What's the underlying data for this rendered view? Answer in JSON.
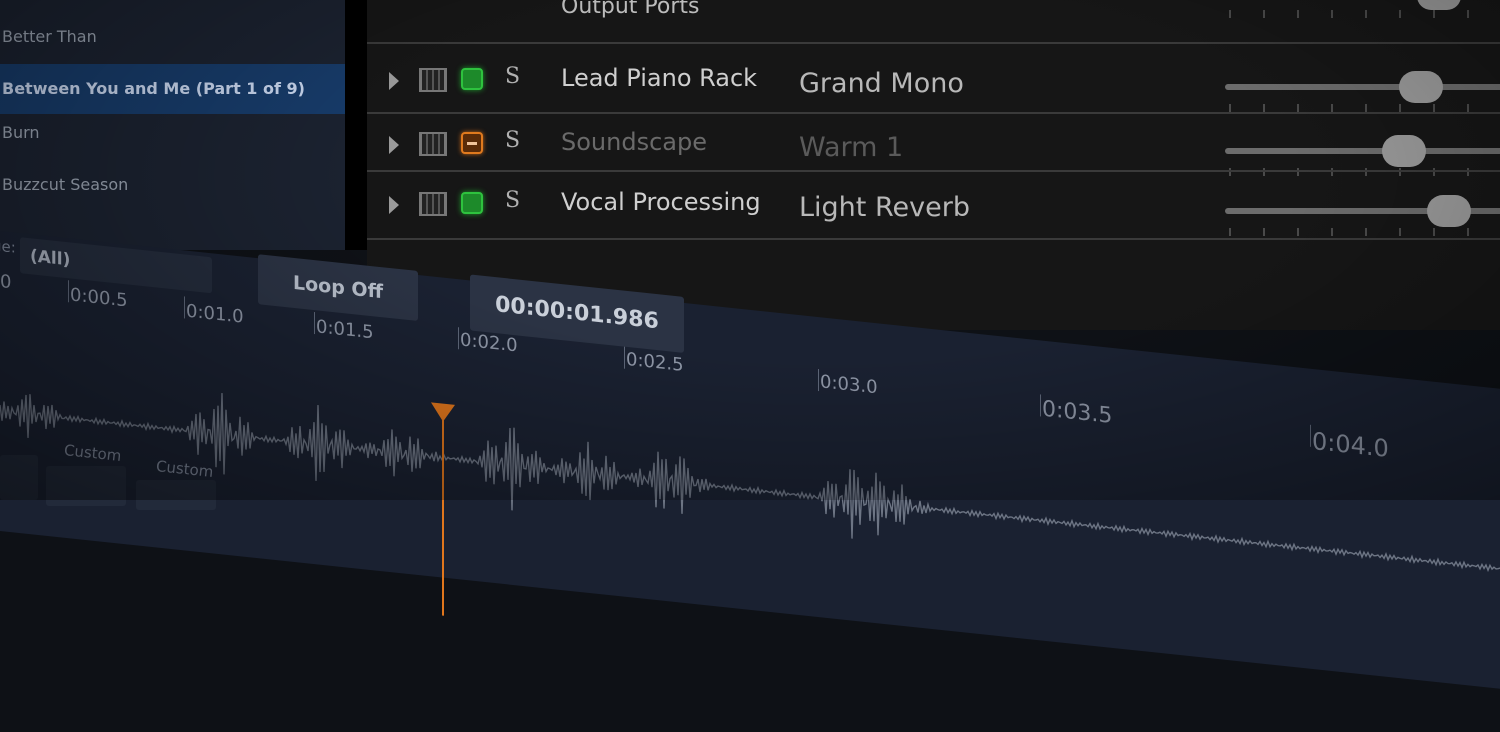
{
  "song_list": {
    "items": [
      {
        "label": "Better Than",
        "selected": false
      },
      {
        "label": "Between You and Me (Part 1 of 9)",
        "selected": true
      },
      {
        "label": "Burn",
        "selected": false
      },
      {
        "label": "Buzzcut Season",
        "selected": false
      }
    ],
    "filter_label": "ge:",
    "filter_value": "(All)"
  },
  "rack_panel": {
    "header": "Output Ports",
    "tracks": [
      {
        "name": "Lead Piano Rack",
        "preset": "Grand Mono",
        "led": "green",
        "solo": "S",
        "dim": false,
        "level": 0.7
      },
      {
        "name": "Soundscape",
        "preset": "Warm 1",
        "led": "orange",
        "solo": "S",
        "dim": true,
        "level": 0.64
      },
      {
        "name": "Vocal Processing",
        "preset": "Light Reverb",
        "led": "green",
        "solo": "S",
        "dim": false,
        "level": 0.8
      }
    ]
  },
  "transport": {
    "loop_label": "Loop Off",
    "time": "00:00:01.986"
  },
  "timeline": {
    "tick_labels": [
      "0:00.5",
      "0:01.0",
      "0:01.5",
      "0:02.0",
      "0:02.5",
      "0:03.0",
      "0:03.5",
      "0:04.0"
    ],
    "first_tick": "0",
    "playhead_color": "#e0761c"
  },
  "pads": {
    "labels": [
      "Custom",
      "Custom"
    ]
  },
  "colors": {
    "selected_row": "#173b69",
    "led_green": "#2ec23e",
    "led_orange": "#e07a1e"
  }
}
